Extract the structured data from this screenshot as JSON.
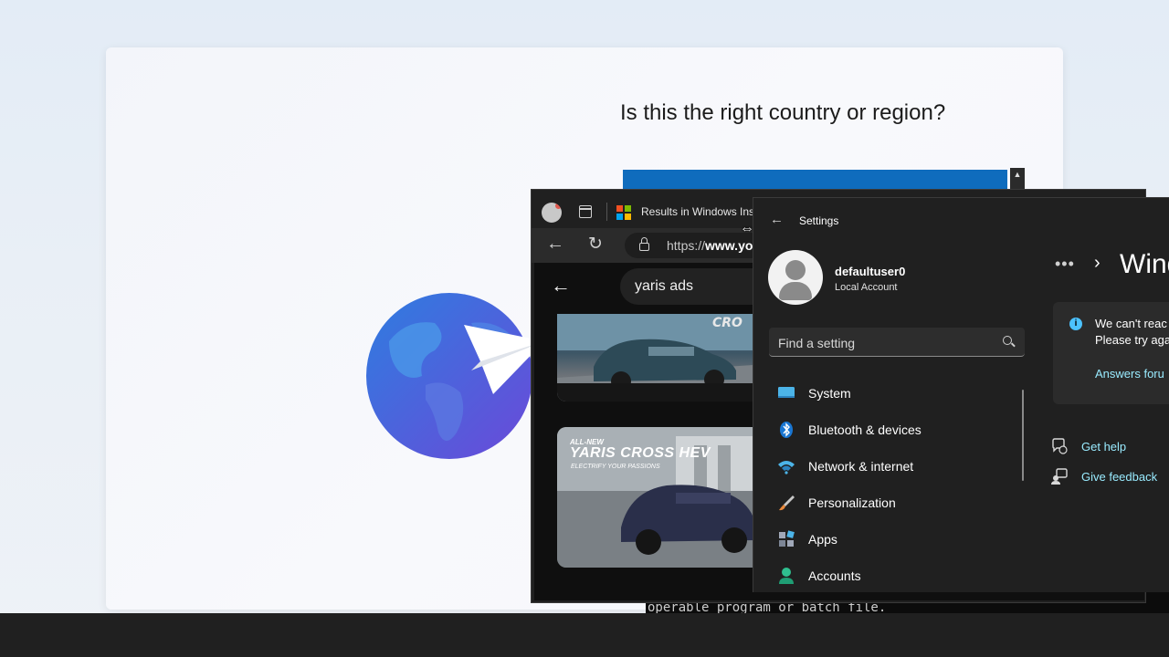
{
  "oobe": {
    "question": "Is this the right country or region?",
    "scroll_glyph": "▲"
  },
  "terminal": {
    "text": "operable program or batch file."
  },
  "browser": {
    "tab_title": "Results in Windows Ins",
    "url_prefix": "https://",
    "url_bold": "www.yo",
    "search_query": "yaris ads",
    "thumb1_overlay": "CRO",
    "thumb2": {
      "brand": "ALL-NEW",
      "title": "YARIS CROSS HEV",
      "subtitle": "ELECTRIFY YOUR PASSIONS"
    }
  },
  "settings": {
    "title": "Settings",
    "user_name": "defaultuser0",
    "account_type": "Local Account",
    "search_placeholder": "Find a setting",
    "nav": [
      {
        "label": "System",
        "icon": "system-icon"
      },
      {
        "label": "Bluetooth & devices",
        "icon": "bluetooth-icon"
      },
      {
        "label": "Network & internet",
        "icon": "wifi-icon"
      },
      {
        "label": "Personalization",
        "icon": "brush-icon"
      },
      {
        "label": "Apps",
        "icon": "apps-icon"
      },
      {
        "label": "Accounts",
        "icon": "accounts-icon"
      }
    ],
    "page_heading": "Wind",
    "info_line1": "We can't reac",
    "info_line2": "Please try aga",
    "info_link": "Answers foru",
    "get_help": "Get help",
    "give_feedback": "Give feedback"
  },
  "colors": {
    "accent_blue": "#0f6cbd",
    "link_cyan": "#99ebff",
    "info_blue": "#4cc2ff",
    "settings_bg": "#202020",
    "taskbar_bg": "#202020"
  }
}
